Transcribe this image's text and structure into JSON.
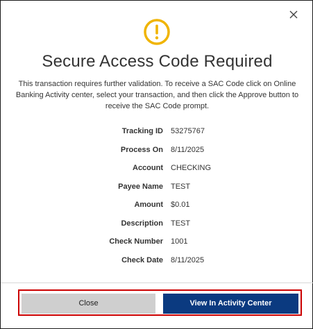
{
  "dialog": {
    "close_icon": "close-icon",
    "alert_icon": "exclamation-circle-icon",
    "alert_color": "#f0b400",
    "title": "Secure Access Code Required",
    "message": "This transaction requires further validation. To receive a SAC Code click on Online Banking Activity center, select your transaction, and then click the Approve button to receive the SAC Code prompt.",
    "details": [
      {
        "label": "Tracking ID",
        "value": "53275767"
      },
      {
        "label": "Process On",
        "value": "8/11/2025"
      },
      {
        "label": "Account",
        "value": "CHECKING"
      },
      {
        "label": "Payee Name",
        "value": "TEST"
      },
      {
        "label": "Amount",
        "value": "$0.01"
      },
      {
        "label": "Description",
        "value": "TEST"
      },
      {
        "label": "Check Number",
        "value": "1001"
      },
      {
        "label": "Check Date",
        "value": "8/11/2025"
      }
    ],
    "buttons": {
      "close_label": "Close",
      "view_label": "View In Activity Center"
    },
    "colors": {
      "primary_button": "#0b3a80",
      "secondary_button": "#cfcfcf",
      "highlight_border": "#cc0000"
    }
  }
}
